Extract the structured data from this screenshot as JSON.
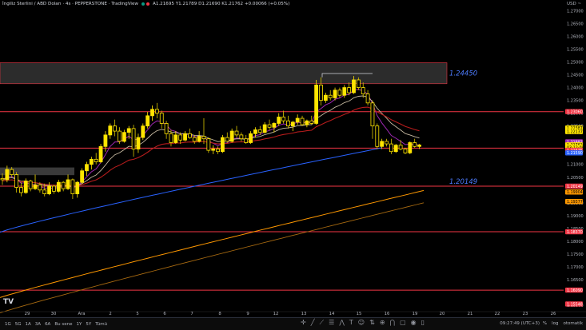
{
  "header": {
    "symbol": "İngiliz Sterlini / ABD Doları · 4s · PEPPERSTONE · TradingView",
    "ohlc": "A1.21695 Y1.21789 D1.21690 K1.21762 +0.00066 (+0.05%)"
  },
  "price_scale": {
    "currency": "USD ~",
    "ticks": [
      {
        "label": "1.27000",
        "v": 1.27
      },
      {
        "label": "1.26500",
        "v": 1.265
      },
      {
        "label": "1.26000",
        "v": 1.26
      },
      {
        "label": "1.25500",
        "v": 1.255
      },
      {
        "label": "1.25000",
        "v": 1.25
      },
      {
        "label": "1.24500",
        "v": 1.245
      },
      {
        "label": "1.24000",
        "v": 1.24
      },
      {
        "label": "1.23500",
        "v": 1.235
      },
      {
        "label": "1.23000",
        "v": 1.23
      },
      {
        "label": "1.22500",
        "v": 1.225
      },
      {
        "label": "1.21500",
        "v": 1.215
      },
      {
        "label": "1.21000",
        "v": 1.21
      },
      {
        "label": "1.20500",
        "v": 1.205
      },
      {
        "label": "1.19500",
        "v": 1.195
      },
      {
        "label": "1.19000",
        "v": 1.19
      },
      {
        "label": "1.18500",
        "v": 1.185
      },
      {
        "label": "1.18000",
        "v": 1.18
      },
      {
        "label": "1.17500",
        "v": 1.175
      },
      {
        "label": "1.17000",
        "v": 1.17
      },
      {
        "label": "1.16500",
        "v": 1.165
      },
      {
        "label": "1.15500",
        "v": 1.155
      }
    ],
    "badges": [
      {
        "label": "1.23060",
        "v": 1.2306,
        "bg": "#f23645",
        "fg": "#ffffff"
      },
      {
        "label": "1.22387",
        "v": 1.2242,
        "bg": "#ffe500",
        "fg": "#000000"
      },
      {
        "label": "1.22137",
        "v": 1.2228,
        "bg": "#ffe500",
        "fg": "#000000"
      },
      {
        "label": "1.21882",
        "v": 1.21882,
        "bg": "#9c27b0",
        "fg": "#ffffff"
      },
      {
        "label": "1.21762",
        "v": 1.21762,
        "bg": "#ffe500",
        "fg": "#000000"
      },
      {
        "label": "03:12:09",
        "v": 1.2166,
        "bg": "#ffe500",
        "fg": "#000000"
      },
      {
        "label": "1.21635",
        "v": 1.2155,
        "bg": "#f23645",
        "fg": "#ffffff"
      },
      {
        "label": "1.21590",
        "v": 1.2145,
        "bg": "#2962ff",
        "fg": "#ffffff"
      },
      {
        "label": "1.20149",
        "v": 1.20149,
        "bg": "#f23645",
        "fg": "#ffffff"
      },
      {
        "label": "1.19904",
        "v": 1.1992,
        "bg": "#ff9800",
        "fg": "#000000"
      },
      {
        "label": "1.19377",
        "v": 1.1955,
        "bg": "#ff9800",
        "fg": "#000000"
      },
      {
        "label": "1.18370",
        "v": 1.1837,
        "bg": "#f23645",
        "fg": "#ffffff"
      },
      {
        "label": "1.16090",
        "v": 1.1609,
        "bg": "#f23645",
        "fg": "#ffffff"
      },
      {
        "label": "1.15548",
        "v": 1.15548,
        "bg": "#f23645",
        "fg": "#ffffff"
      }
    ]
  },
  "time_axis": [
    {
      "label": "29",
      "x": 34
    },
    {
      "label": "30",
      "x": 67
    },
    {
      "label": "Ara",
      "x": 102
    },
    {
      "label": "2",
      "x": 138
    },
    {
      "label": "5",
      "x": 172
    },
    {
      "label": "6",
      "x": 206
    },
    {
      "label": "7",
      "x": 240
    },
    {
      "label": "8",
      "x": 275
    },
    {
      "label": "9",
      "x": 310
    },
    {
      "label": "12",
      "x": 345
    },
    {
      "label": "13",
      "x": 380
    },
    {
      "label": "14",
      "x": 415
    },
    {
      "label": "15",
      "x": 449
    },
    {
      "label": "16",
      "x": 484
    },
    {
      "label": "19",
      "x": 519
    },
    {
      "label": "20",
      "x": 553
    },
    {
      "label": "21",
      "x": 588
    },
    {
      "label": "22",
      "x": 622
    },
    {
      "label": "23",
      "x": 657
    },
    {
      "label": "26",
      "x": 692
    }
  ],
  "annotations": {
    "top_level": "1.24450",
    "bottom_level": "1.20149"
  },
  "chart_data": {
    "type": "candlestick",
    "symbol": "GBPUSD",
    "interval": "4s",
    "ylim": [
      1.1525,
      1.2742
    ],
    "horizontal_levels": [
      1.2306,
      1.21635,
      1.20149,
      1.1837,
      1.1609
    ],
    "zone": [
      1.2415,
      1.2497
    ],
    "candles": [
      [
        1.2045,
        1.2065,
        1.202,
        1.204
      ],
      [
        1.204,
        1.2095,
        1.203,
        1.208
      ],
      [
        1.208,
        1.209,
        1.205,
        1.206
      ],
      [
        1.206,
        1.207,
        1.199,
        1.201
      ],
      [
        1.201,
        1.203,
        1.1975,
        1.199
      ],
      [
        1.199,
        1.2045,
        1.1985,
        1.2035
      ],
      [
        1.2035,
        1.204,
        1.1995,
        1.2005
      ],
      [
        1.2005,
        1.206,
        1.2,
        1.202
      ],
      [
        1.202,
        1.203,
        1.199,
        1.2
      ],
      [
        1.2,
        1.2025,
        1.1975,
        1.1985
      ],
      [
        1.1985,
        1.203,
        1.198,
        1.2015
      ],
      [
        1.2015,
        1.202,
        1.1985,
        1.1995
      ],
      [
        1.1995,
        1.204,
        1.199,
        1.203
      ],
      [
        1.203,
        1.2035,
        1.1995,
        1.2005
      ],
      [
        1.2005,
        1.206,
        1.2,
        1.204
      ],
      [
        1.204,
        1.2045,
        1.1965,
        1.1985
      ],
      [
        1.1985,
        1.2035,
        1.197,
        1.203
      ],
      [
        1.203,
        1.2085,
        1.2025,
        1.2075
      ],
      [
        1.2075,
        1.211,
        1.2055,
        1.21
      ],
      [
        1.21,
        1.213,
        1.208,
        1.212
      ],
      [
        1.212,
        1.2145,
        1.21,
        1.211
      ],
      [
        1.211,
        1.218,
        1.2105,
        1.217
      ],
      [
        1.217,
        1.223,
        1.215,
        1.2215
      ],
      [
        1.2215,
        1.226,
        1.22,
        1.225
      ],
      [
        1.225,
        1.2275,
        1.221,
        1.223
      ],
      [
        1.223,
        1.2245,
        1.218,
        1.219
      ],
      [
        1.219,
        1.2235,
        1.2185,
        1.2225
      ],
      [
        1.2225,
        1.225,
        1.22,
        1.224
      ],
      [
        1.224,
        1.2255,
        1.213,
        1.216
      ],
      [
        1.216,
        1.222,
        1.2145,
        1.2205
      ],
      [
        1.2205,
        1.226,
        1.2195,
        1.225
      ],
      [
        1.225,
        1.2305,
        1.224,
        1.229
      ],
      [
        1.229,
        1.233,
        1.227,
        1.2315
      ],
      [
        1.2315,
        1.234,
        1.228,
        1.23
      ],
      [
        1.23,
        1.231,
        1.224,
        1.226
      ],
      [
        1.226,
        1.227,
        1.22,
        1.222
      ],
      [
        1.222,
        1.2235,
        1.217,
        1.2185
      ],
      [
        1.2185,
        1.223,
        1.218,
        1.2215
      ],
      [
        1.2215,
        1.2225,
        1.218,
        1.2195
      ],
      [
        1.2195,
        1.223,
        1.219,
        1.222
      ],
      [
        1.222,
        1.224,
        1.22,
        1.2205
      ],
      [
        1.2205,
        1.2215,
        1.218,
        1.219
      ],
      [
        1.219,
        1.223,
        1.2185,
        1.221
      ],
      [
        1.221,
        1.228,
        1.218,
        1.22
      ],
      [
        1.22,
        1.2205,
        1.2145,
        1.2155
      ],
      [
        1.2155,
        1.2175,
        1.214,
        1.216
      ],
      [
        1.216,
        1.217,
        1.214,
        1.215
      ],
      [
        1.215,
        1.2215,
        1.2145,
        1.2205
      ],
      [
        1.2205,
        1.2225,
        1.2185,
        1.219
      ],
      [
        1.219,
        1.224,
        1.2185,
        1.223
      ],
      [
        1.223,
        1.225,
        1.2205,
        1.2215
      ],
      [
        1.2215,
        1.2225,
        1.219,
        1.22
      ],
      [
        1.22,
        1.2215,
        1.218,
        1.2185
      ],
      [
        1.2185,
        1.223,
        1.218,
        1.222
      ],
      [
        1.222,
        1.2245,
        1.2205,
        1.2235
      ],
      [
        1.2235,
        1.225,
        1.2215,
        1.2225
      ],
      [
        1.2225,
        1.2265,
        1.222,
        1.2255
      ],
      [
        1.2255,
        1.2275,
        1.2235,
        1.2245
      ],
      [
        1.2245,
        1.2265,
        1.2225,
        1.226
      ],
      [
        1.226,
        1.23,
        1.225,
        1.2285
      ],
      [
        1.2285,
        1.231,
        1.226,
        1.227
      ],
      [
        1.227,
        1.229,
        1.224,
        1.225
      ],
      [
        1.225,
        1.227,
        1.223,
        1.2265
      ],
      [
        1.2265,
        1.2295,
        1.2255,
        1.228
      ],
      [
        1.228,
        1.229,
        1.225,
        1.2255
      ],
      [
        1.2255,
        1.2275,
        1.2245,
        1.227
      ],
      [
        1.227,
        1.229,
        1.2255,
        1.226
      ],
      [
        1.226,
        1.243,
        1.2255,
        1.241
      ],
      [
        1.241,
        1.244,
        1.233,
        1.235
      ],
      [
        1.235,
        1.238,
        1.234,
        1.237
      ],
      [
        1.237,
        1.239,
        1.235,
        1.236
      ],
      [
        1.236,
        1.24,
        1.235,
        1.239
      ],
      [
        1.239,
        1.24,
        1.236,
        1.237
      ],
      [
        1.237,
        1.241,
        1.236,
        1.24
      ],
      [
        1.24,
        1.242,
        1.237,
        1.238
      ],
      [
        1.238,
        1.2445,
        1.2375,
        1.243
      ],
      [
        1.243,
        1.244,
        1.239,
        1.24
      ],
      [
        1.24,
        1.242,
        1.236,
        1.2375
      ],
      [
        1.2375,
        1.239,
        1.233,
        1.234
      ],
      [
        1.234,
        1.235,
        1.22,
        1.225
      ],
      [
        1.225,
        1.226,
        1.216,
        1.217
      ],
      [
        1.217,
        1.22,
        1.216,
        1.219
      ],
      [
        1.219,
        1.22,
        1.217,
        1.218
      ],
      [
        1.218,
        1.22,
        1.214,
        1.215
      ],
      [
        1.215,
        1.218,
        1.2145,
        1.2175
      ],
      [
        1.2175,
        1.2195,
        1.2155,
        1.216
      ],
      [
        1.216,
        1.2165,
        1.214,
        1.2145
      ],
      [
        1.2145,
        1.219,
        1.214,
        1.2185
      ],
      [
        1.2185,
        1.22,
        1.2165,
        1.217
      ],
      [
        1.217,
        1.218,
        1.216,
        1.2176
      ]
    ]
  }
}
